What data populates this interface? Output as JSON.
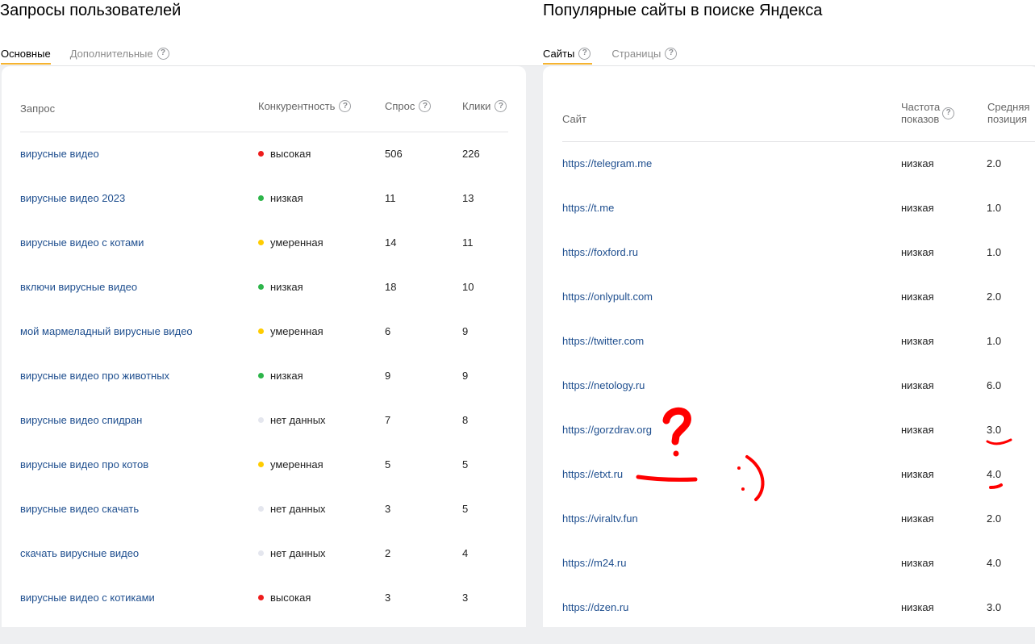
{
  "left": {
    "title": "Запросы пользователей",
    "tabs": [
      {
        "label": "Основные",
        "active": true,
        "help": false
      },
      {
        "label": "Дополнительные",
        "active": false,
        "help": true
      }
    ],
    "columns": {
      "query": "Запрос",
      "competition": "Конкурентность",
      "demand": "Спрос",
      "clicks": "Клики"
    },
    "rows": [
      {
        "query": "вирусные видео",
        "competition": "высокая",
        "level": "high",
        "demand": "506",
        "clicks": "226"
      },
      {
        "query": "вирусные видео 2023",
        "competition": "низкая",
        "level": "low",
        "demand": "11",
        "clicks": "13"
      },
      {
        "query": "вирусные видео с котами",
        "competition": "умеренная",
        "level": "medium",
        "demand": "14",
        "clicks": "11"
      },
      {
        "query": "включи вирусные видео",
        "competition": "низкая",
        "level": "low",
        "demand": "18",
        "clicks": "10"
      },
      {
        "query": "мой мармеладный вирусные видео",
        "competition": "умеренная",
        "level": "medium",
        "demand": "6",
        "clicks": "9"
      },
      {
        "query": "вирусные видео про животных",
        "competition": "низкая",
        "level": "low",
        "demand": "9",
        "clicks": "9"
      },
      {
        "query": "вирусные видео спидран",
        "competition": "нет данных",
        "level": "none",
        "demand": "7",
        "clicks": "8"
      },
      {
        "query": "вирусные видео про котов",
        "competition": "умеренная",
        "level": "medium",
        "demand": "5",
        "clicks": "5"
      },
      {
        "query": "вирусные видео скачать",
        "competition": "нет данных",
        "level": "none",
        "demand": "3",
        "clicks": "5"
      },
      {
        "query": "скачать вирусные видео",
        "competition": "нет данных",
        "level": "none",
        "demand": "2",
        "clicks": "4"
      },
      {
        "query": "вирусные видео с котиками",
        "competition": "высокая",
        "level": "high",
        "demand": "3",
        "clicks": "3"
      }
    ]
  },
  "right": {
    "title": "Популярные сайты в поиске Яндекса",
    "tabs": [
      {
        "label": "Сайты",
        "active": true,
        "help": true
      },
      {
        "label": "Страницы",
        "active": false,
        "help": true
      }
    ],
    "columns": {
      "site": "Сайт",
      "freq_line1": "Частота",
      "freq_line2": "показов",
      "pos_line1": "Средняя",
      "pos_line2": "позиция"
    },
    "rows": [
      {
        "site": "https://telegram.me",
        "freq": "низкая",
        "pos": "2.0"
      },
      {
        "site": "https://t.me",
        "freq": "низкая",
        "pos": "1.0"
      },
      {
        "site": "https://foxford.ru",
        "freq": "низкая",
        "pos": "1.0"
      },
      {
        "site": "https://onlypult.com",
        "freq": "низкая",
        "pos": "2.0"
      },
      {
        "site": "https://twitter.com",
        "freq": "низкая",
        "pos": "1.0"
      },
      {
        "site": "https://netology.ru",
        "freq": "низкая",
        "pos": "6.0"
      },
      {
        "site": "https://gorzdrav.org",
        "freq": "низкая",
        "pos": "3.0"
      },
      {
        "site": "https://etxt.ru",
        "freq": "низкая",
        "pos": "4.0"
      },
      {
        "site": "https://viraltv.fun",
        "freq": "низкая",
        "pos": "2.0"
      },
      {
        "site": "https://m24.ru",
        "freq": "низкая",
        "pos": "4.0"
      },
      {
        "site": "https://dzen.ru",
        "freq": "низкая",
        "pos": "3.0"
      }
    ]
  },
  "icons": {
    "help": "?"
  },
  "colors": {
    "high": "#ee1c1c",
    "low": "#2db54a",
    "medium": "#ffcc00",
    "none": "#e4e6ee",
    "link": "#1f4f8f",
    "tab_active": "#f5b330",
    "annotation": "#ff0000"
  }
}
